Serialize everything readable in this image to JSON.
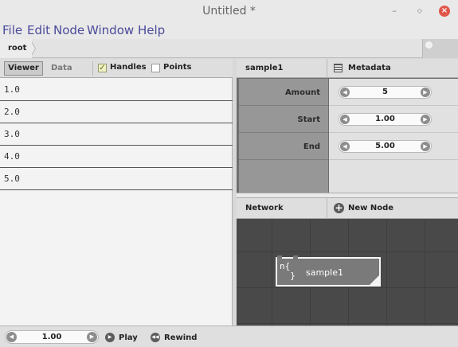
{
  "window": {
    "title": "Untitled *",
    "minimize_glyph": "–",
    "maximize_glyph": "◇",
    "close_glyph": "×"
  },
  "menu": [
    "File",
    "Edit",
    "Node",
    "Window",
    "Help"
  ],
  "breadcrumb": {
    "root": "root"
  },
  "viewer": {
    "tabs": {
      "viewer": "Viewer",
      "data": "Data"
    },
    "handles_label": "Handles",
    "handles_checked": true,
    "points_label": "Points",
    "points_checked": false,
    "values": [
      "1.0",
      "2.0",
      "3.0",
      "4.0",
      "5.0"
    ]
  },
  "parameters": {
    "node_name": "sample1",
    "metadata_label": "Metadata",
    "rows": [
      {
        "name": "Amount",
        "value": "5"
      },
      {
        "name": "Start",
        "value": "1.00"
      },
      {
        "name": "End",
        "value": "5.00"
      }
    ]
  },
  "network": {
    "title": "Network",
    "new_node_label": "New Node",
    "node": {
      "label": "sample1",
      "icon_glyph": "n{x/y}"
    }
  },
  "playback": {
    "frame": "1.00",
    "play_label": "Play",
    "rewind_label": "Rewind"
  },
  "colors": {
    "node_fill": "#7a7a7a",
    "canvas_bg": "#494949",
    "menu_text": "#4a4a9a",
    "close_button": "#e0564b"
  }
}
